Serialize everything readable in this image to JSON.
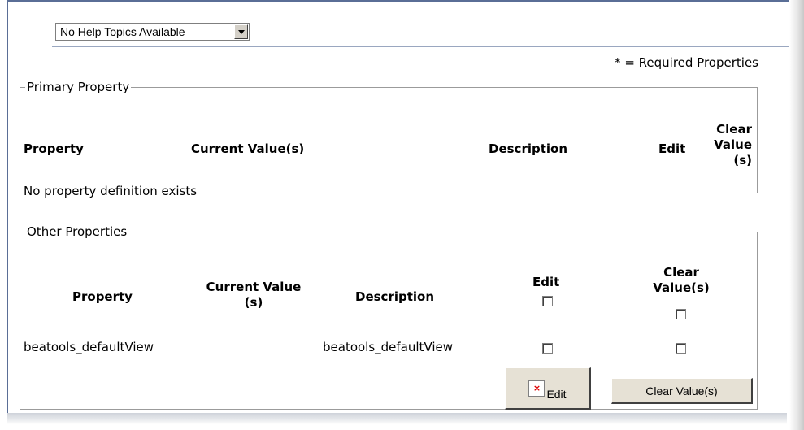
{
  "help": {
    "selected": "No Help Topics Available"
  },
  "required_note": "* = Required Properties",
  "primary": {
    "legend": "Primary Property",
    "headers": {
      "property": "Property",
      "current": "Current Value(s)",
      "description": "Description",
      "edit": "Edit",
      "clear_line1": "Clear",
      "clear_line2": "Value",
      "clear_line3": "(s)"
    },
    "empty_message": "No property definition exists"
  },
  "other": {
    "legend": "Other Properties",
    "headers": {
      "property": "Property",
      "current_line1": "Current Value",
      "current_line2": "(s)",
      "description": "Description",
      "edit": "Edit",
      "clear_line1": "Clear",
      "clear_line2": "Value(s)"
    },
    "rows": [
      {
        "property": "beatools_defaultView",
        "current": "",
        "description": "beatools_defaultView"
      }
    ],
    "buttons": {
      "edit": "Edit",
      "clear": "Clear Value(s)"
    }
  },
  "icons": {
    "broken_image": "broken-image-icon",
    "dropdown": "chevron-down-icon"
  }
}
